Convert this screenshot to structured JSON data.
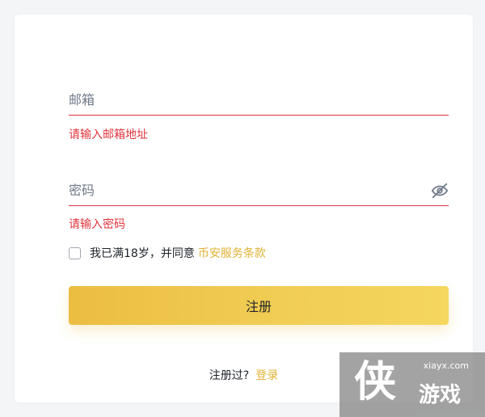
{
  "form": {
    "email": {
      "placeholder": "邮箱",
      "value": "",
      "error": "请输入邮箱地址"
    },
    "password": {
      "placeholder": "密码",
      "value": "",
      "error": "请输入密码",
      "toggle_icon": "eye-off-icon"
    },
    "agreement": {
      "checked": false,
      "text": "我已满18岁，并同意",
      "link": "币安服务条款"
    },
    "submit_label": "注册",
    "footer": {
      "text": "注册过?",
      "link": "登录"
    }
  },
  "colors": {
    "accent": "#e0b234",
    "error": "#e0353d",
    "button_start": "#ebbd42",
    "button_end": "#f5d65e",
    "text": "#1e2329",
    "placeholder": "#707a8a"
  },
  "watermark": {
    "url": "xiayx.com",
    "big_char": "侠",
    "name": "游戏"
  }
}
